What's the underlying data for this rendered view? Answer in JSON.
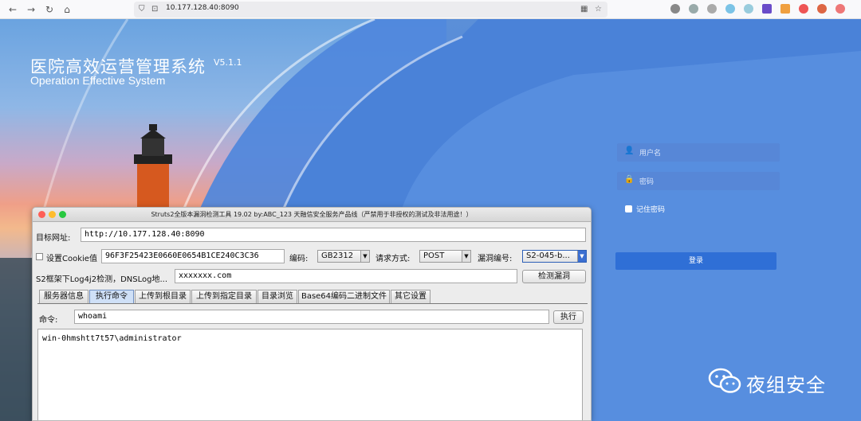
{
  "browser": {
    "url": "10.177.128.40:8090"
  },
  "page": {
    "title": "医院高效运营管理系统",
    "version": "V5.1.1",
    "subtitle": "Operation Effective System",
    "login": {
      "username_placeholder": "用户名",
      "password_placeholder": "密码",
      "remember_label": "记住密码",
      "submit_label": "登录"
    },
    "watermark": "夜组安全"
  },
  "tool": {
    "title": "Struts2全版本漏洞检测工具 19.02 by:ABC_123 天融信安全服务产品线（严禁用于非授权的测试及非法用途！）",
    "target_label": "目标网址:",
    "target_value": "http://10.177.128.40:8090",
    "cookie_label": "设置Cookie值",
    "cookie_value": "96F3F25423E0660E0654B1CE240C3C36",
    "encoding_label": "编码:",
    "encoding_value": "GB2312",
    "method_label": "请求方式:",
    "method_value": "POST",
    "vuln_label": "漏洞编号:",
    "vuln_value": "S2-045-b...",
    "dnslog_label": "S2框架下Log4j2检测，DNSLog地...",
    "dnslog_value": "xxxxxxx.com",
    "detect_button": "检测漏洞",
    "tabs": [
      "服务器信息",
      "执行命令",
      "上传到根目录",
      "上传到指定目录",
      "目录浏览",
      "Base64编码二进制文件",
      "其它设置"
    ],
    "command_label": "命令:",
    "command_value": "whoami",
    "execute_button": "执行",
    "output": "win-0hmshtt7t57\\administrator"
  },
  "colors": {
    "page_bg": "#4f86dc",
    "login_button": "#2f6fd6",
    "active_tab": "#cfe0f7"
  }
}
